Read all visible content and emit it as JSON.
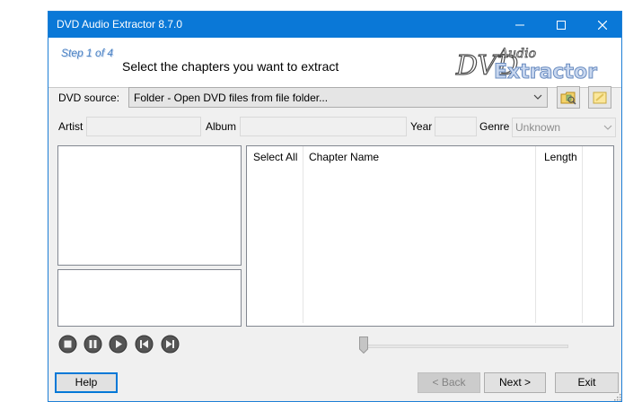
{
  "window": {
    "title": "DVD Audio Extractor 8.7.0"
  },
  "titlebar": {
    "minimize": "–",
    "maximize": "☐",
    "close": "✕"
  },
  "header": {
    "step": "Step 1 of 4",
    "instruction": "Select the chapters you want to extract",
    "logo": {
      "word1": "DVD",
      "word2": "Audio",
      "word3": "Extractor"
    }
  },
  "source": {
    "label": "DVD source:",
    "value": "Folder - Open DVD files from file folder...",
    "open_icon": "folder-open-icon",
    "edit_icon": "note-icon"
  },
  "meta": {
    "artist_label": "Artist",
    "album_label": "Album",
    "year_label": "Year",
    "genre_label": "Genre",
    "genre_value": "Unknown"
  },
  "chapters": {
    "columns": [
      "Select All",
      "Chapter Name",
      "Length"
    ]
  },
  "player": {
    "icons": [
      "stop-icon",
      "pause-icon",
      "play-icon",
      "previous-icon",
      "next-icon"
    ],
    "position": 0
  },
  "buttons": {
    "help": "Help",
    "back": "< Back",
    "next": "Next >",
    "exit": "Exit"
  },
  "colors": {
    "titlebar": "#0a78d7",
    "window_bg": "#f0f0f0",
    "accent_border": "#0078d7"
  }
}
